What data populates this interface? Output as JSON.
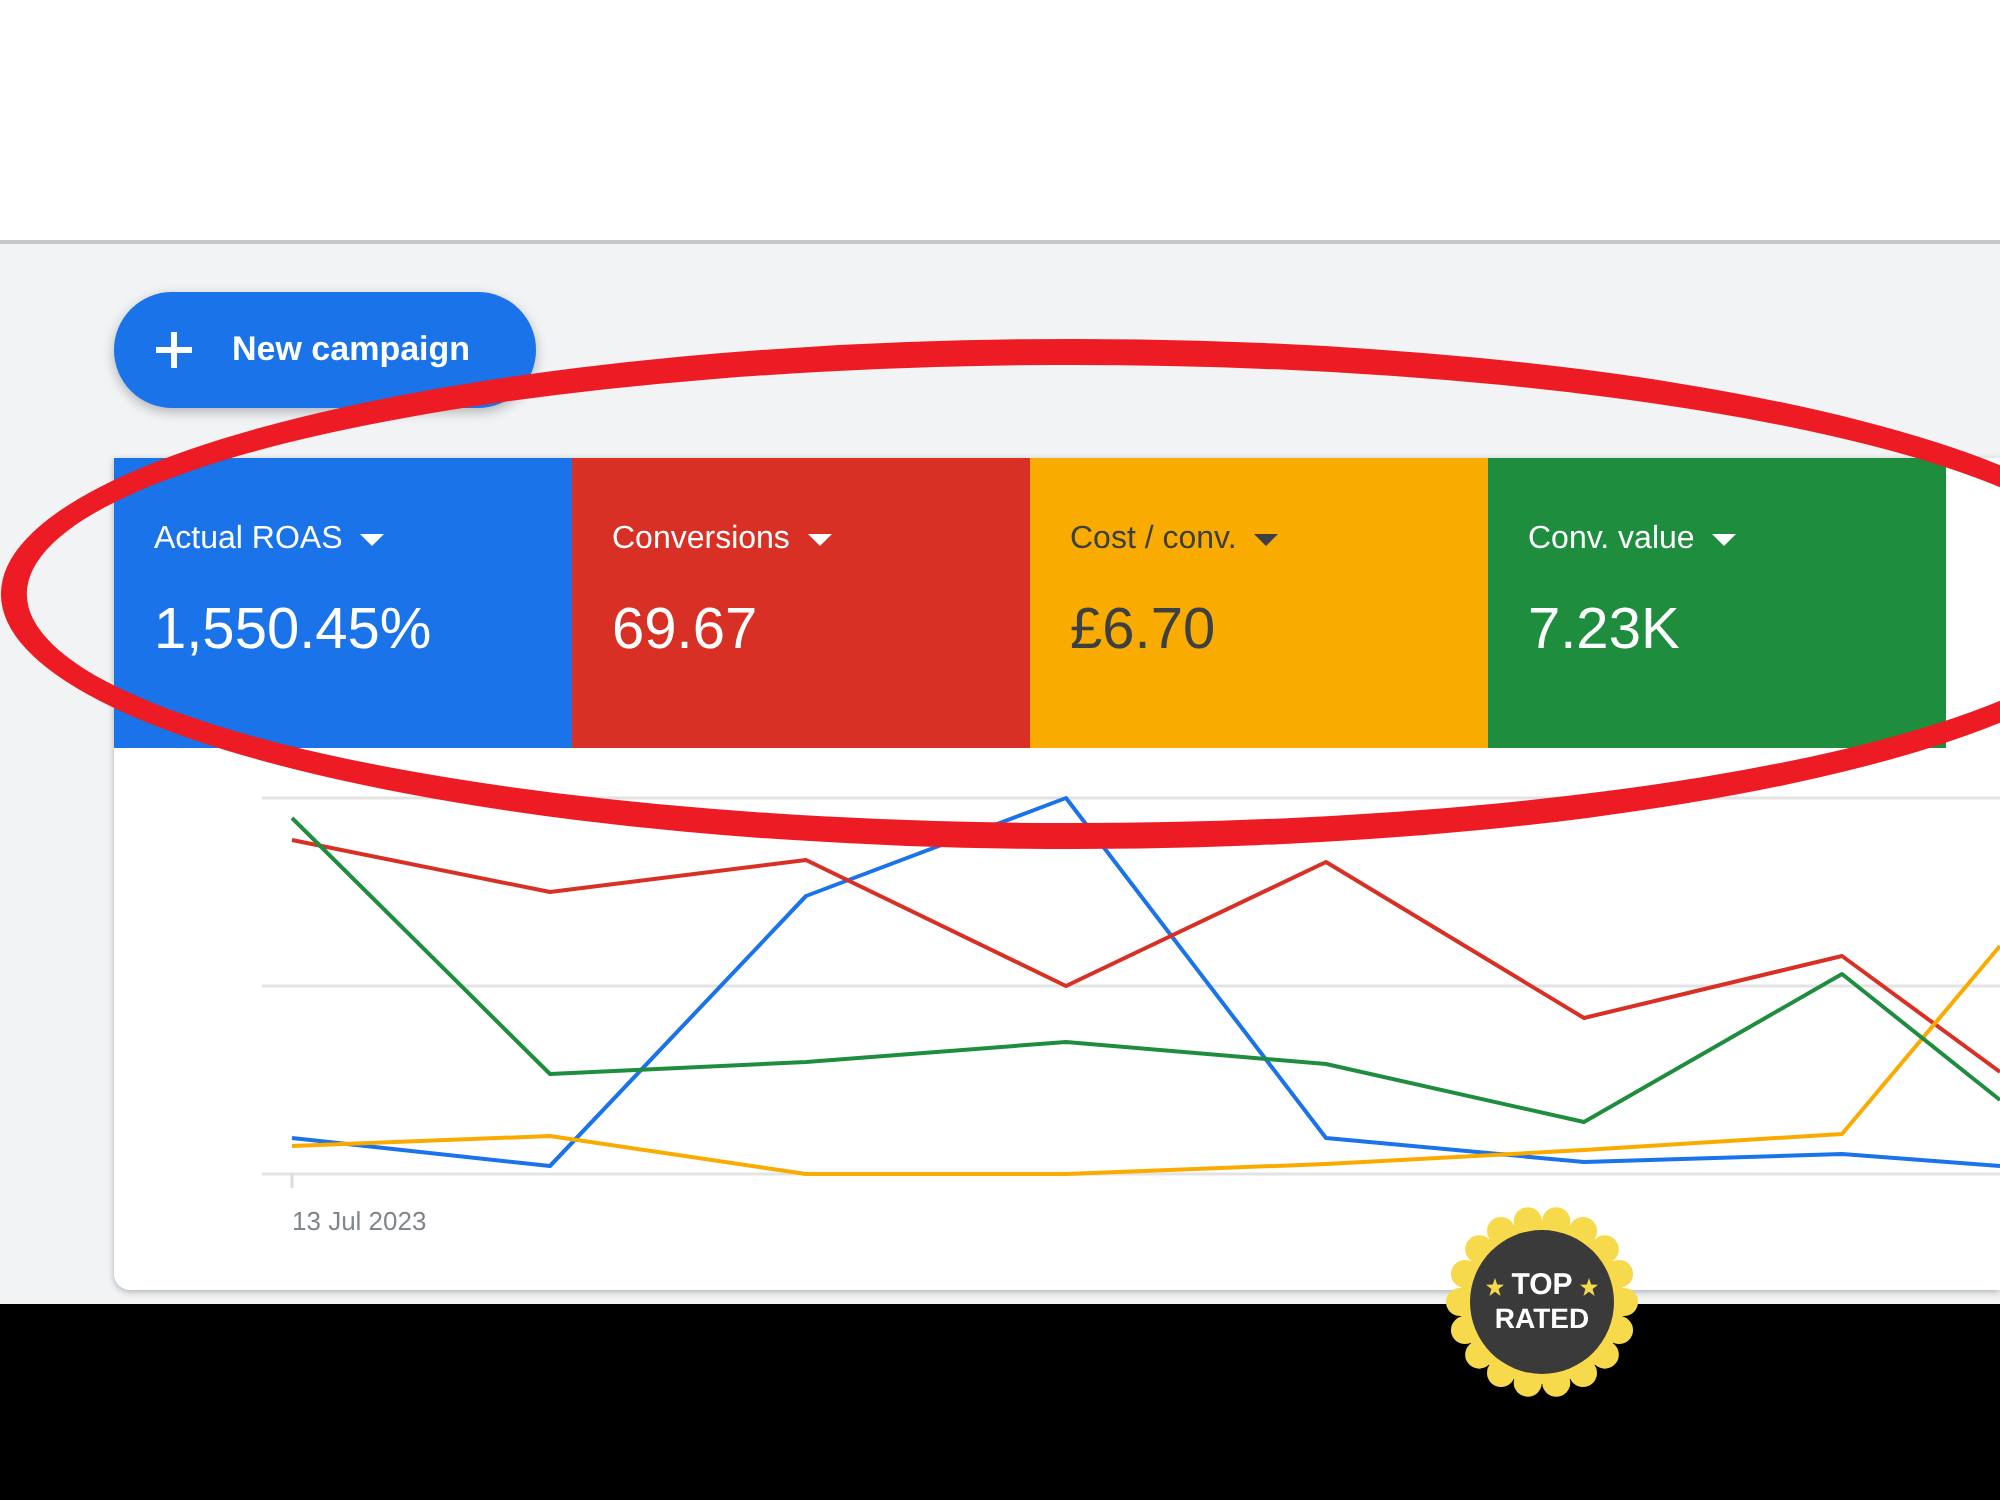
{
  "toolbar": {
    "new_button": {
      "label": "New campaign"
    }
  },
  "metrics": [
    {
      "label": "Actual ROAS",
      "value": "1,550.45%",
      "color": "#1a73e8"
    },
    {
      "label": "Conversions",
      "value": "69.67",
      "color": "#d93025"
    },
    {
      "label": "Cost / conv.",
      "value": "£6.70",
      "color": "#f9ab00"
    },
    {
      "label": "Conv. value",
      "value": "7.23K",
      "color": "#1e8e3e"
    }
  ],
  "chart": {
    "x_label": "13 Jul 2023"
  },
  "badge": {
    "top": "TOP",
    "bottom": "RATED"
  }
}
